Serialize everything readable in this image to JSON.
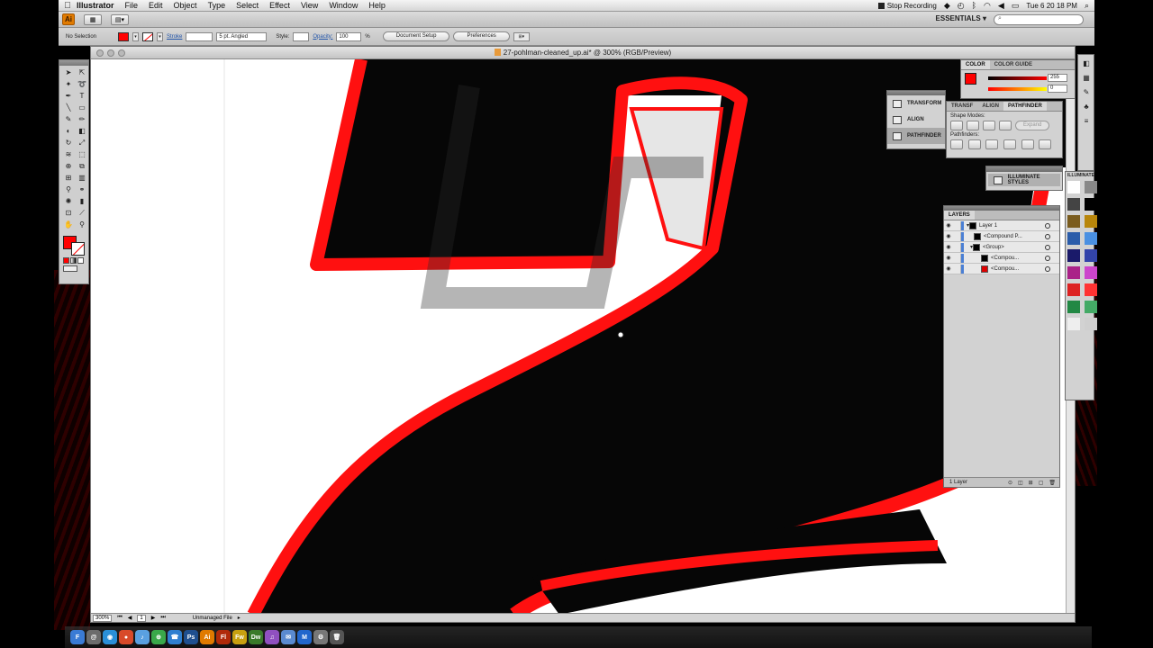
{
  "menubar": {
    "app_name": "Illustrator",
    "items": [
      "File",
      "Edit",
      "Object",
      "Type",
      "Select",
      "Effect",
      "View",
      "Window",
      "Help"
    ],
    "stop_recording": "Stop Recording",
    "clock": "Tue 6 20 18 PM"
  },
  "appbar": {
    "logo": "Ai",
    "workspace": "ESSENTIALS ▾"
  },
  "controlbar": {
    "selection": "No Selection",
    "stroke_label": "Stroke",
    "brush": "5 pt. Angled",
    "style_label": "Style:",
    "opacity_label": "Opacity:",
    "opacity_value": "100",
    "percent": "%",
    "document_setup": "Document Setup",
    "preferences": "Preferences",
    "fill_color": "#ff0000"
  },
  "document": {
    "title": "27-pohlman-cleaned_up.ai* @ 300% (RGB/Preview)",
    "zoom": "300%",
    "page": "1",
    "status": "Unmanaged File"
  },
  "dock_panels": {
    "items": [
      "TRANSFORM",
      "ALIGN",
      "PATHFINDER"
    ],
    "selected": "PATHFINDER"
  },
  "color_panel": {
    "tabs": [
      "COLOR",
      "COLOR GUIDE"
    ],
    "value_r": "255",
    "value_g": "0"
  },
  "pathfinder_panel": {
    "tabs": [
      "TRANSF",
      "ALIGN",
      "PATHFINDER"
    ],
    "shape_modes": "Shape Modes:",
    "expand": "Expand",
    "pathfinders": "Pathfinders:"
  },
  "illuminate": {
    "title": "ILLUMINATE STYLES",
    "side_tab": "ILLUMINATE"
  },
  "layers_panel": {
    "title": "LAYERS",
    "rows": [
      {
        "name": "Layer 1"
      },
      {
        "name": "<Compound P..."
      },
      {
        "name": "<Group>"
      },
      {
        "name": "<Compou..."
      },
      {
        "name": "<Compou..."
      }
    ],
    "footer": "1 Layer"
  },
  "swatches": [
    "#ffffff",
    "#888888",
    "#444444",
    "#000000",
    "#7a5c1e",
    "#b8860b",
    "#2a5caa",
    "#4a90e2",
    "#1a1a6a",
    "#3344aa",
    "#aa2288",
    "#cc44cc",
    "#dd2222",
    "#ff3333",
    "#228844",
    "#44aa66",
    "#eeeeee",
    "#cfcfcf"
  ],
  "dock_apps": [
    {
      "label": "F",
      "color": "#3a7bd5"
    },
    {
      "label": "@",
      "color": "#6c6c6c"
    },
    {
      "label": "◉",
      "color": "#2a8fd8"
    },
    {
      "label": "●",
      "color": "#d84a2a"
    },
    {
      "label": "♪",
      "color": "#5aa0e0"
    },
    {
      "label": "⊕",
      "color": "#3aa84a"
    },
    {
      "label": "☎",
      "color": "#2f7fd0"
    },
    {
      "label": "Ps",
      "color": "#1f4f8f"
    },
    {
      "label": "Ai",
      "color": "#e07a00"
    },
    {
      "label": "Fl",
      "color": "#b02a0a"
    },
    {
      "label": "Fw",
      "color": "#c8a010"
    },
    {
      "label": "Dw",
      "color": "#3a7a2a"
    },
    {
      "label": "♫",
      "color": "#9050c0"
    },
    {
      "label": "✉",
      "color": "#5a8ad0"
    },
    {
      "label": "M",
      "color": "#2266cc"
    },
    {
      "label": "⚙",
      "color": "#777777"
    },
    {
      "label": "🗑",
      "color": "#555555"
    }
  ]
}
